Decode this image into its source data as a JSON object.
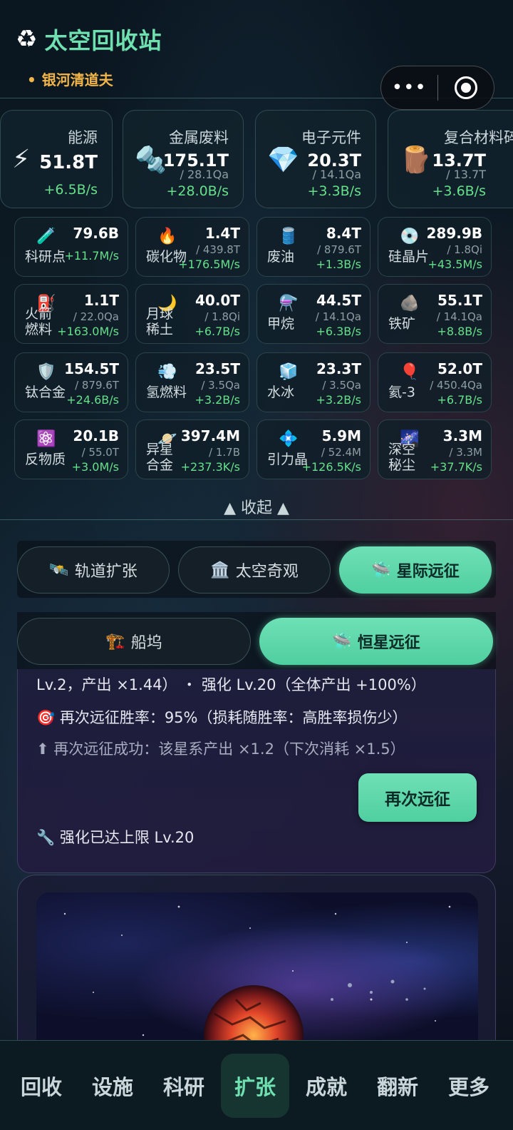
{
  "header": {
    "logo_icon": "recycle-icon",
    "title": "太空回收站",
    "subtitle": "银河清道夫"
  },
  "main_resources": [
    {
      "icon": "⚡",
      "icon_name": "lightning-icon",
      "name": "能源",
      "value": "51.8T",
      "cap": "",
      "rate": "+6.5B/s"
    },
    {
      "icon": "🔩",
      "icon_name": "bolt-icon",
      "name": "金属废料",
      "value": "175.1T",
      "cap": "/ 28.1Qa",
      "rate": "+28.0B/s"
    },
    {
      "icon": "💎",
      "icon_name": "gem-icon",
      "name": "电子元件",
      "value": "20.3T",
      "cap": "/ 14.1Qa",
      "rate": "+3.3B/s"
    },
    {
      "icon": "🪵",
      "icon_name": "wood-icon",
      "name": "复合材料碎",
      "value": "13.7T",
      "cap": "/ 13.7T",
      "rate": "+3.6B/s"
    }
  ],
  "resources": [
    {
      "icon": "🧪",
      "icon_name": "test-tube-icon",
      "name": "科研点",
      "value": "79.6B",
      "cap": "",
      "rate": "+11.7M/s"
    },
    {
      "icon": "🔥",
      "icon_name": "fire-icon",
      "name": "碳化物",
      "value": "1.4T",
      "cap": "/ 439.8T",
      "rate": "+176.5M/s"
    },
    {
      "icon": "🛢️",
      "icon_name": "oil-barrel-icon",
      "name": "废油",
      "value": "8.4T",
      "cap": "/ 879.6T",
      "rate": "+1.3B/s"
    },
    {
      "icon": "💿",
      "icon_name": "disc-icon",
      "name": "硅晶片",
      "value": "289.9B",
      "cap": "/ 1.8Qi",
      "rate": "+43.5M/s"
    },
    {
      "icon": "⛽",
      "icon_name": "fuel-pump-icon",
      "name": "火箭燃料",
      "value": "1.1T",
      "cap": "/ 22.0Qa",
      "rate": "+163.0M/s"
    },
    {
      "icon": "🌙",
      "icon_name": "moon-icon",
      "name": "月球稀土",
      "value": "40.0T",
      "cap": "/ 1.8Qi",
      "rate": "+6.7B/s"
    },
    {
      "icon": "⚗️",
      "icon_name": "alembic-icon",
      "name": "甲烷",
      "value": "44.5T",
      "cap": "/ 14.1Qa",
      "rate": "+6.3B/s"
    },
    {
      "icon": "🪨",
      "icon_name": "rock-icon",
      "name": "铁矿",
      "value": "55.1T",
      "cap": "/ 14.1Qa",
      "rate": "+8.8B/s"
    },
    {
      "icon": "🛡️",
      "icon_name": "shield-icon",
      "name": "钛合金",
      "value": "154.5T",
      "cap": "/ 879.6T",
      "rate": "+24.6B/s"
    },
    {
      "icon": "💨",
      "icon_name": "wind-icon",
      "name": "氢燃料",
      "value": "23.5T",
      "cap": "/ 3.5Qa",
      "rate": "+3.2B/s"
    },
    {
      "icon": "🧊",
      "icon_name": "ice-cube-icon",
      "name": "水冰",
      "value": "23.3T",
      "cap": "/ 3.5Qa",
      "rate": "+3.2B/s"
    },
    {
      "icon": "🎈",
      "icon_name": "balloon-icon",
      "name": "氦-3",
      "value": "52.0T",
      "cap": "/ 450.4Qa",
      "rate": "+6.7B/s"
    },
    {
      "icon": "⚛️",
      "icon_name": "atom-icon",
      "name": "反物质",
      "value": "20.1B",
      "cap": "/ 55.0T",
      "rate": "+3.0M/s"
    },
    {
      "icon": "🪐",
      "icon_name": "planet-icon",
      "name": "异星合金",
      "value": "397.4M",
      "cap": "/ 1.7B",
      "rate": "+237.3K/s"
    },
    {
      "icon": "💠",
      "icon_name": "diamond-shape-icon",
      "name": "引力晶",
      "value": "5.9M",
      "cap": "/ 52.4M",
      "rate": "+126.5K/s"
    },
    {
      "icon": "🌌",
      "icon_name": "galaxy-icon",
      "name": "深空秘尘",
      "value": "3.3M",
      "cap": "/ 3.3M",
      "rate": "+37.7K/s"
    }
  ],
  "collapse_label": "▲ 收起 ▲",
  "tabs_primary": [
    {
      "icon": "🛰️",
      "label": "轨道扩张"
    },
    {
      "icon": "🏛️",
      "label": "太空奇观"
    },
    {
      "icon": "🛸",
      "label": "星际远征"
    }
  ],
  "tabs_secondary": [
    {
      "icon": "🏗️",
      "label": "船坞"
    },
    {
      "icon": "🛸",
      "label": "恒星远征"
    }
  ],
  "expedition": {
    "line1": "Lv.2，产出 ×1.44） ・ 强化 Lv.20（全体产出 +100%）",
    "line2": "🎯 再次远征胜率：95%（损耗随胜率：高胜率损伤少）",
    "line3": "⬆ 再次远征成功：该星系产出 ×1.2（下次消耗 ×1.5）",
    "again_button": "再次远征",
    "line4": "🔧 强化已达上限 Lv.20"
  },
  "bottom_nav": [
    "回收",
    "设施",
    "科研",
    "扩张",
    "成就",
    "翻新",
    "更多"
  ],
  "active_nav": "扩张",
  "colors": {
    "accent": "#6fe0b0",
    "rate": "#66e08a",
    "subtitle": "#f2b54a"
  }
}
